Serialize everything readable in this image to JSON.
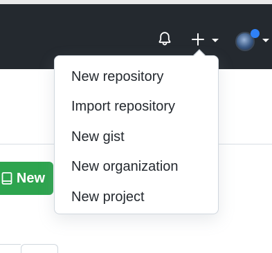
{
  "header": {
    "notifications_icon": "bell-icon",
    "create_icon": "plus-icon",
    "create_caret_icon": "caret-down-icon",
    "avatar_caret_icon": "caret-down-icon",
    "bg_color": "#24292f"
  },
  "create_menu": {
    "items": [
      {
        "label": "New repository"
      },
      {
        "label": "Import repository"
      },
      {
        "label": "New gist"
      },
      {
        "label": "New organization"
      },
      {
        "label": "New project"
      }
    ]
  },
  "main": {
    "new_button_label": "New",
    "new_button_icon": "repo-icon",
    "accent_color": "#2da44e"
  }
}
